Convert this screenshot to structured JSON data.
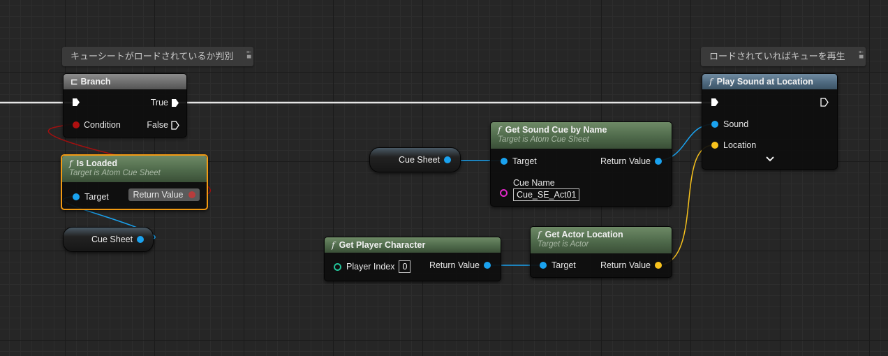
{
  "comments": {
    "left": "キューシートがロードされているか判別",
    "right": "ロードされていればキューを再生"
  },
  "branch": {
    "title": "Branch",
    "true_label": "True",
    "condition_label": "Condition",
    "false_label": "False"
  },
  "is_loaded": {
    "title": "Is Loaded",
    "subtitle": "Target is Atom Cue Sheet",
    "target_label": "Target",
    "return_label": "Return Value"
  },
  "cue_sheet_var_left": {
    "label": "Cue Sheet"
  },
  "cue_sheet_var_mid": {
    "label": "Cue Sheet"
  },
  "get_sound_cue": {
    "title": "Get Sound Cue by Name",
    "subtitle": "Target is Atom Cue Sheet",
    "target_label": "Target",
    "return_label": "Return Value",
    "cue_name_label": "Cue Name",
    "cue_name_value": "Cue_SE_Act01"
  },
  "play_sound": {
    "title": "Play Sound at Location",
    "sound_label": "Sound",
    "location_label": "Location",
    "expand_icon": "chevron-down-icon"
  },
  "get_player_character": {
    "title": "Get Player Character",
    "player_index_label": "Player Index",
    "player_index_value": "0",
    "return_label": "Return Value"
  },
  "get_actor_location": {
    "title": "Get Actor Location",
    "subtitle": "Target is Actor",
    "target_label": "Target",
    "return_label": "Return Value"
  },
  "colors": {
    "object_pin": "#1aa2ef",
    "bool_pin": "#b01010",
    "vector_pin": "#f7c21d",
    "int_pin": "#23c49a",
    "name_pin": "#e028c8",
    "selection": "#f29a12"
  },
  "icons": {
    "function": "function-icon",
    "branch": "branch-icon",
    "comment_controls": "comment-collapse-icon"
  }
}
